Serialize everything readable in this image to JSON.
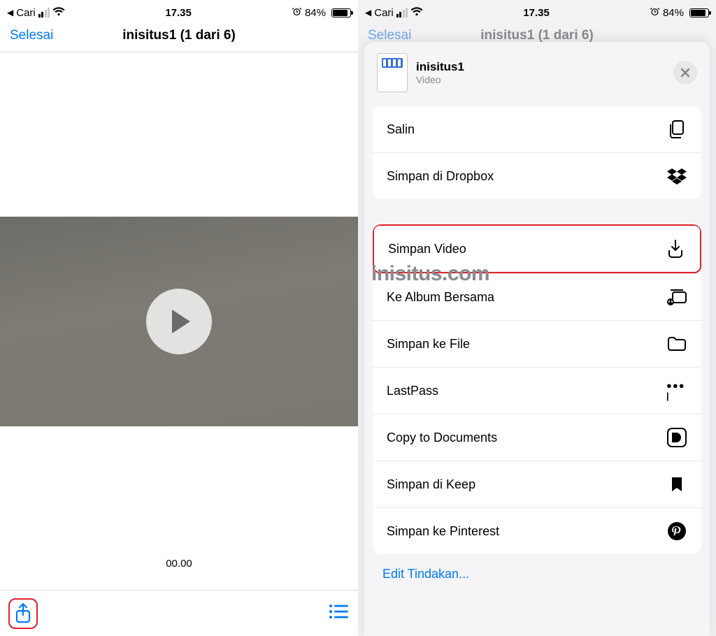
{
  "status": {
    "back_label": "Cari",
    "time": "17.35",
    "battery_pct": "84%"
  },
  "left": {
    "done": "Selesai",
    "title": "inisitus1 (1 dari 6)",
    "time_code": "00.00"
  },
  "right": {
    "dim_done": "Selesai",
    "dim_title": "inisitus1 (1 dari 6)",
    "sheet": {
      "title": "inisitus1",
      "subtitle": "Video",
      "actions": [
        {
          "label": "Salin",
          "icon": "copy"
        },
        {
          "label": "Simpan di Dropbox",
          "icon": "dropbox"
        },
        {
          "label": "Simpan Video",
          "icon": "download",
          "highlight": true
        },
        {
          "label": "Ke Album Bersama",
          "icon": "shared-album"
        },
        {
          "label": "Simpan ke File",
          "icon": "folder"
        },
        {
          "label": "LastPass",
          "icon": "lastpass"
        },
        {
          "label": "Copy to Documents",
          "icon": "documents-app"
        },
        {
          "label": "Simpan di Keep",
          "icon": "bookmark"
        },
        {
          "label": "Simpan ke Pinterest",
          "icon": "pinterest"
        }
      ],
      "edit": "Edit Tindakan..."
    }
  },
  "watermark": "inisitus.com"
}
